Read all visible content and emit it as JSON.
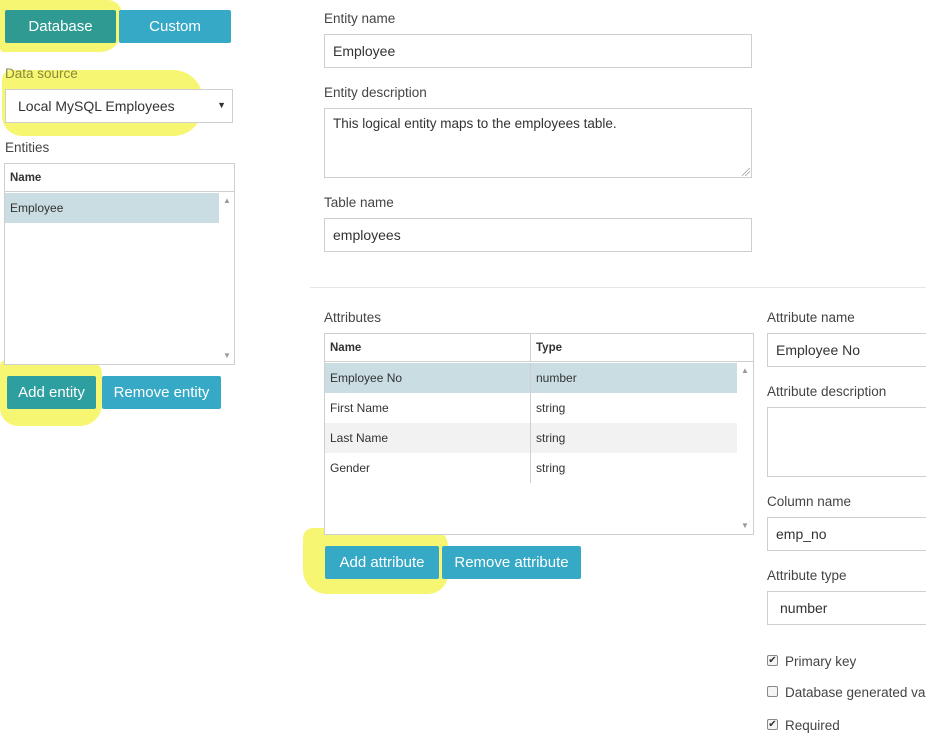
{
  "colors": {
    "accent": "#35a9c6",
    "highlight": "#f5f55a",
    "selected_row": "#c9dde2",
    "alt_row": "#f2f2f2"
  },
  "source_tabs": {
    "database": "Database",
    "custom": "Custom"
  },
  "data_source": {
    "label": "Data source",
    "value": "Local MySQL Employees"
  },
  "entities": {
    "label": "Entities",
    "column_name": "Name",
    "items": [
      "Employee"
    ],
    "add_label": "Add entity",
    "remove_label": "Remove entity"
  },
  "entity_form": {
    "name_label": "Entity name",
    "name_value": "Employee",
    "description_label": "Entity description",
    "description_value": "This logical entity maps to the employees table.",
    "table_label": "Table name",
    "table_value": "employees"
  },
  "attributes": {
    "label": "Attributes",
    "columns": [
      "Name",
      "Type"
    ],
    "rows": [
      {
        "name": "Employee No",
        "type": "number"
      },
      {
        "name": "First Name",
        "type": "string"
      },
      {
        "name": "Last Name",
        "type": "string"
      },
      {
        "name": "Gender",
        "type": "string"
      }
    ],
    "add_label": "Add attribute",
    "remove_label": "Remove attribute"
  },
  "attribute_form": {
    "name_label": "Attribute name",
    "name_value": "Employee No",
    "description_label": "Attribute description",
    "description_value": "",
    "column_label": "Column name",
    "column_value": "emp_no",
    "type_label": "Attribute type",
    "type_value": "number",
    "primary_key_label": "Primary key",
    "primary_key_checked": true,
    "db_generated_label": "Database generated va",
    "db_generated_checked": false,
    "required_label": "Required",
    "required_checked": true
  }
}
